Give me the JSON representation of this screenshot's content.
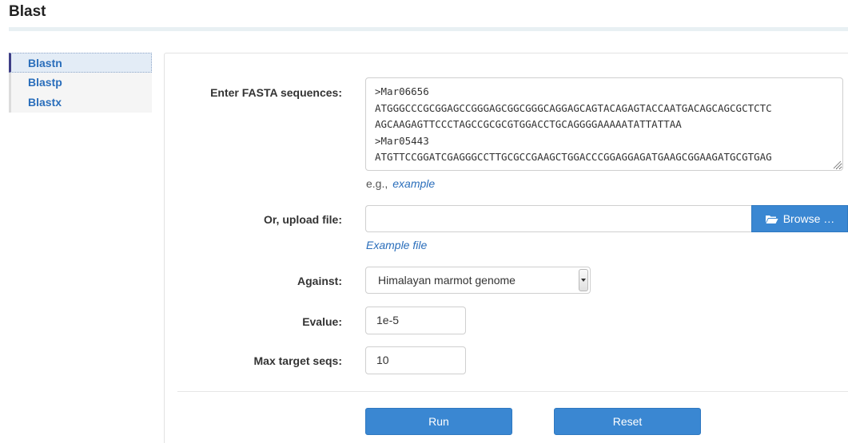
{
  "page": {
    "title": "Blast"
  },
  "sidebar": {
    "items": [
      {
        "label": "Blastn"
      },
      {
        "label": "Blastp"
      },
      {
        "label": "Blastx"
      }
    ]
  },
  "form": {
    "fasta_label": "Enter FASTA sequences:",
    "fasta_value": ">Mar06656\nATGGGCCCGCGGAGCCGGGAGCGGCGGGCAGGAGCAGTACAGAGTACCAATGACAGCAGCGCTCTC\nAGCAAGAGTTCCCTAGCCGCGCGTGGACCTGCAGGGGAAAAATATTATTAA\n>Mar05443\nATGTTCCGGATCGAGGGCCTTGCGCCGAAGCTGGACCCGGAGGAGATGAAGCGGAAGATGCGTGAG",
    "eg_text": "e.g.,",
    "eg_link": "example",
    "upload_label": "Or, upload file:",
    "upload_value": "",
    "browse_label": "Browse …",
    "example_file_link": "Example file",
    "against_label": "Against:",
    "against_selected": "Himalayan marmot genome",
    "evalue_label": "Evalue:",
    "evalue_value": "1e-5",
    "max_target_label": "Max target seqs:",
    "max_target_value": "10",
    "run_label": "Run",
    "reset_label": "Reset"
  },
  "colors": {
    "accent": "#3a87d2",
    "link": "#2a6ebb",
    "active_border": "#3e3e86"
  }
}
